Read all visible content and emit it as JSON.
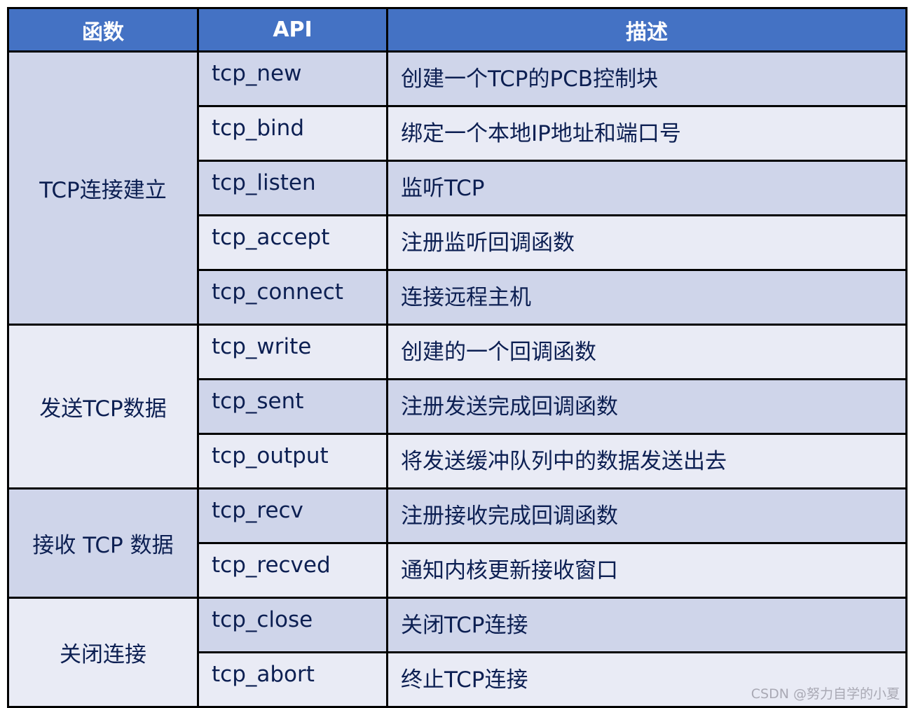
{
  "headers": [
    "函数",
    "API",
    "描述"
  ],
  "groups": [
    {
      "label": "TCP连接建立",
      "rows": [
        {
          "api": "tcp_new",
          "desc": "创建一个TCP的PCB控制块"
        },
        {
          "api": "tcp_bind",
          "desc": "绑定一个本地IP地址和端口号"
        },
        {
          "api": "tcp_listen",
          "desc": "监听TCP"
        },
        {
          "api": "tcp_accept",
          "desc": "注册监听回调函数"
        },
        {
          "api": "tcp_connect",
          "desc": "连接远程主机"
        }
      ]
    },
    {
      "label": "发送TCP数据",
      "rows": [
        {
          "api": "tcp_write",
          "desc": "创建的一个回调函数"
        },
        {
          "api": "tcp_sent",
          "desc": "注册发送完成回调函数"
        },
        {
          "api": "tcp_output",
          "desc": "将发送缓冲队列中的数据发送出去"
        }
      ]
    },
    {
      "label": "接收 TCP 数据",
      "rows": [
        {
          "api": "tcp_recv",
          "desc": "注册接收完成回调函数"
        },
        {
          "api": "tcp_recved",
          "desc": "通知内核更新接收窗口"
        }
      ]
    },
    {
      "label": "关闭连接",
      "rows": [
        {
          "api": "tcp_close",
          "desc": "关闭TCP连接"
        },
        {
          "api": "tcp_abort",
          "desc": "终止TCP连接"
        }
      ]
    }
  ],
  "watermark": "CSDN @努力自学的小夏"
}
